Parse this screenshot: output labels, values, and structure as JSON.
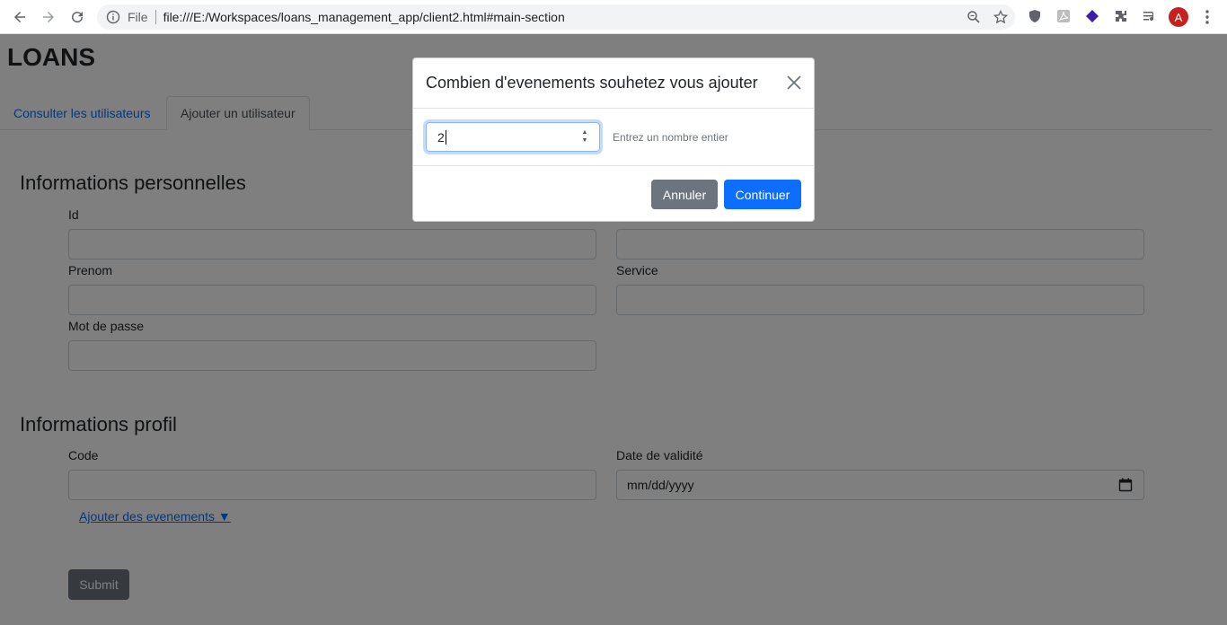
{
  "browser": {
    "file_label": "File",
    "url": "file:///E:/Workspaces/loans_management_app/client2.html#main-section",
    "avatar_letter": "A"
  },
  "app": {
    "title": "LOANS",
    "tabs": [
      {
        "label": "Consulter les utilisateurs",
        "active": false
      },
      {
        "label": "Ajouter un utilisateur",
        "active": true
      }
    ]
  },
  "personal": {
    "title": "Informations personnelles",
    "id_label": "Id",
    "prenom_label": "Prenom",
    "service_label": "Service",
    "password_label": "Mot de passe"
  },
  "profile": {
    "title": "Informations profil",
    "code_label": "Code",
    "date_label": "Date de validité",
    "date_placeholder": "mm/dd/yyyy",
    "add_events_link": "Ajouter des evenements ▼",
    "submit_label": "Submit"
  },
  "modal": {
    "title": "Combien d'evenements souhetez vous ajouter",
    "input_value": "2",
    "hint": "Entrez un nombre entier",
    "cancel_label": "Annuler",
    "continue_label": "Continuer"
  },
  "colors": {
    "primary": "#0d6efd",
    "secondary": "#6c757d",
    "avatar": "#c5221f"
  }
}
